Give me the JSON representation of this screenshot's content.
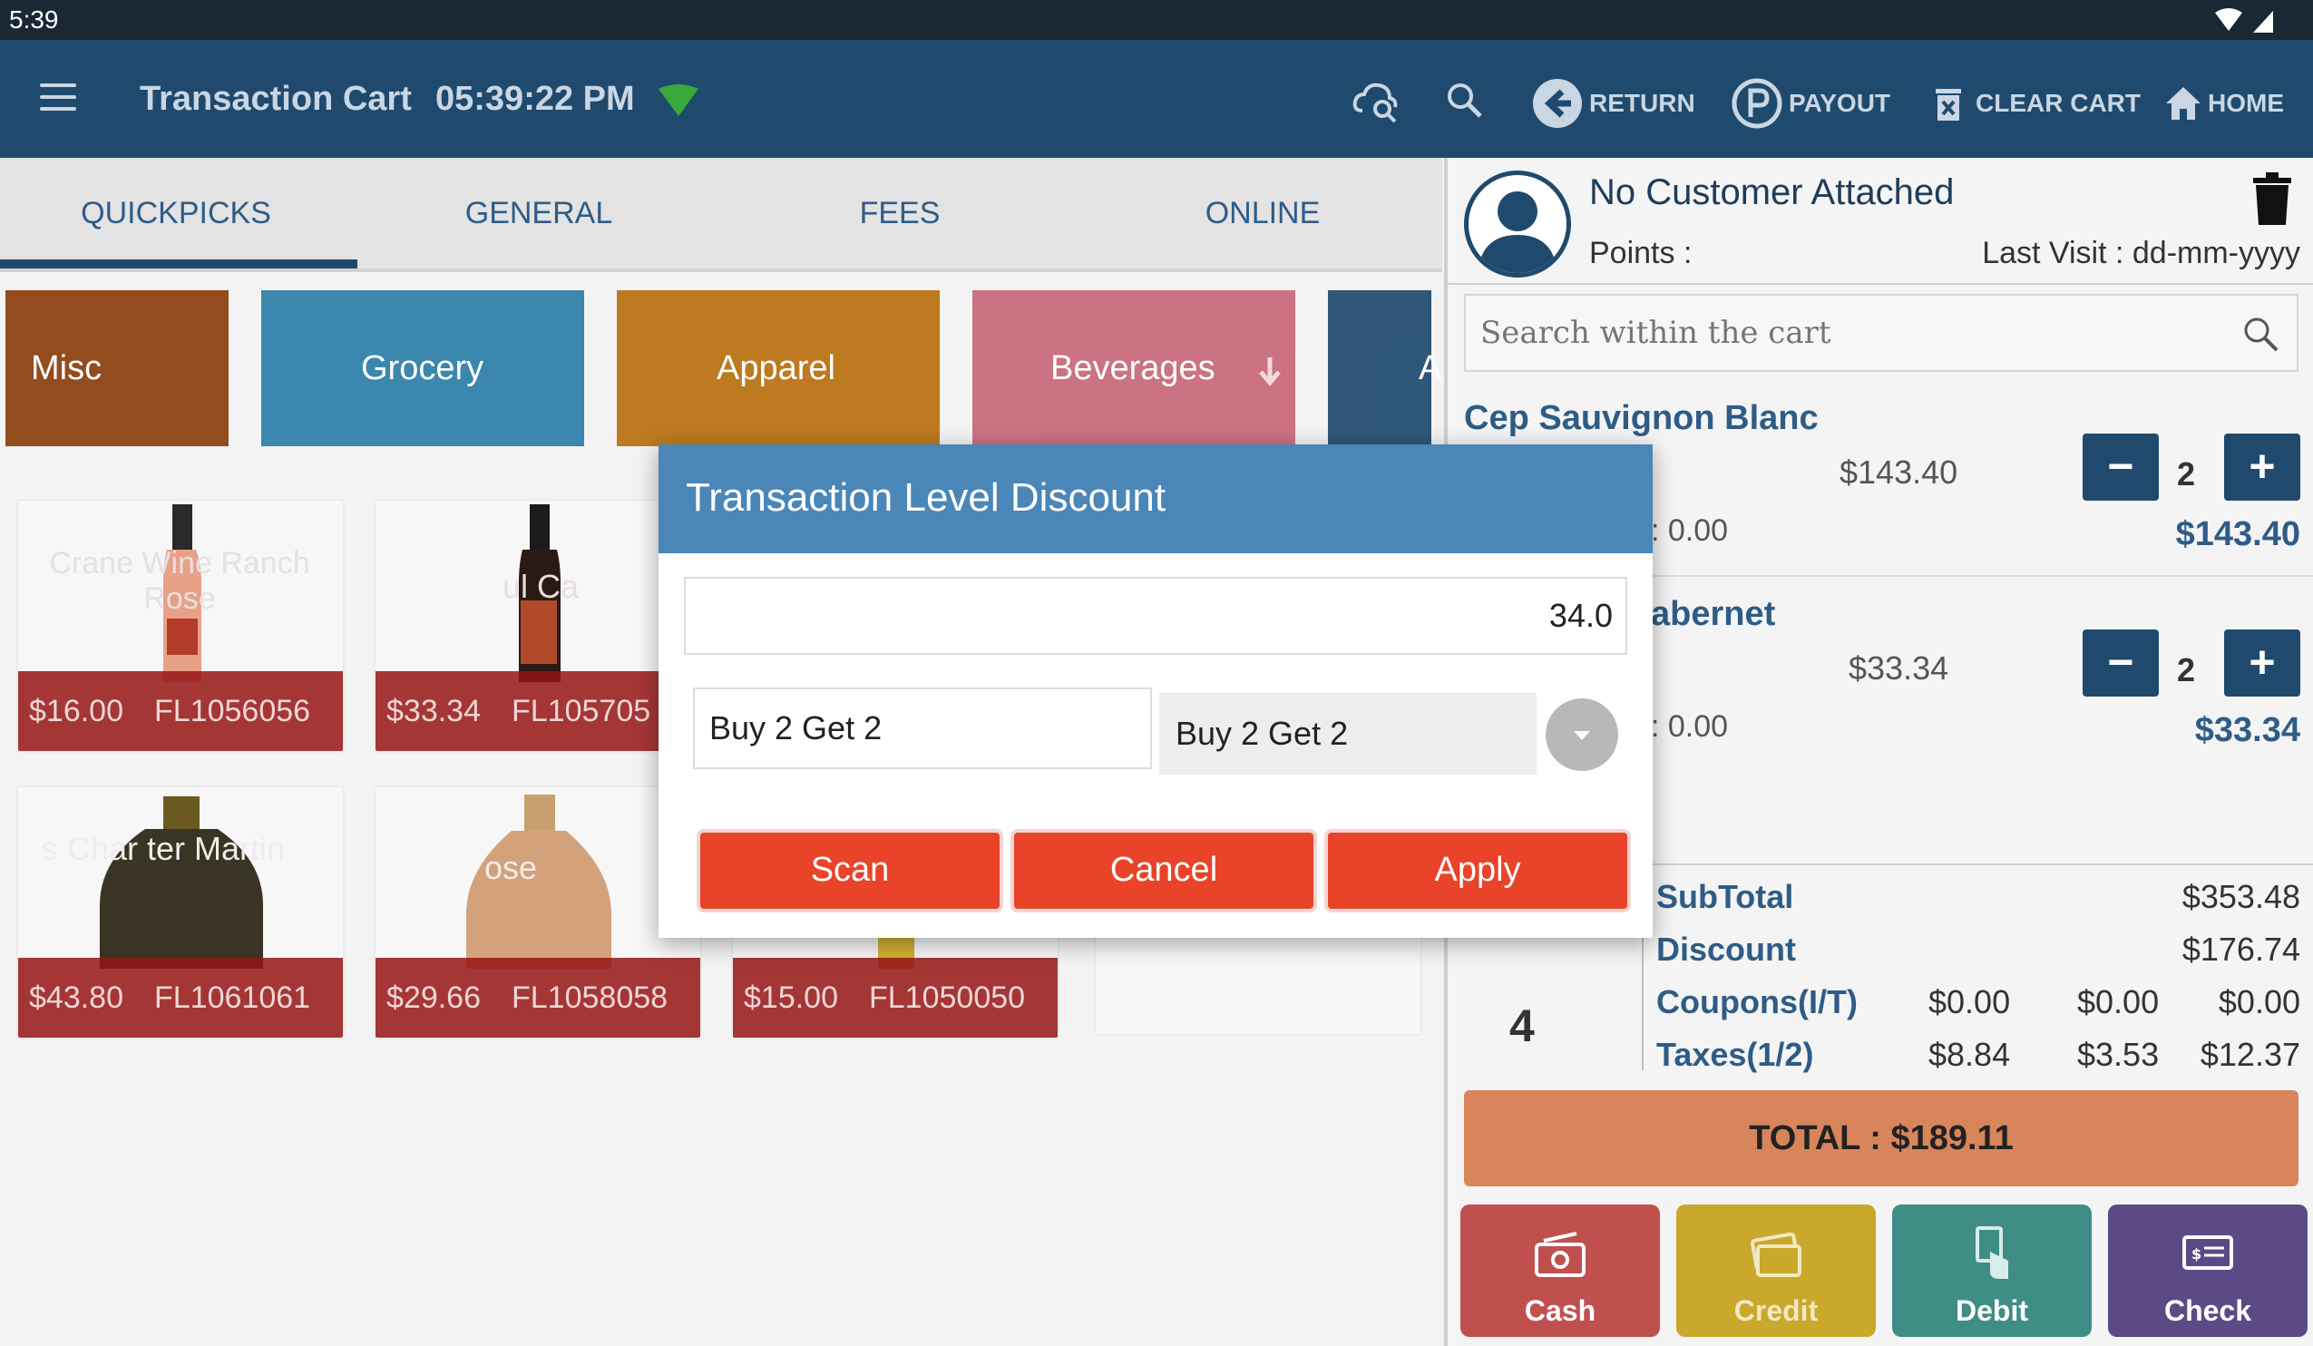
{
  "status_bar": {
    "time": "5:39"
  },
  "app_bar": {
    "title": "Transaction Cart",
    "clock": "05:39:22 PM",
    "actions": {
      "return": "RETURN",
      "payout": "PAYOUT",
      "clear_cart": "CLEAR CART",
      "home": "HOME"
    }
  },
  "tabs": [
    {
      "label": "QUICKPICKS",
      "active": true
    },
    {
      "label": "GENERAL",
      "active": false
    },
    {
      "label": "FEES",
      "active": false
    },
    {
      "label": "ONLINE",
      "active": false
    }
  ],
  "categories": [
    {
      "label": "Misc",
      "color": "#8a3e0c"
    },
    {
      "label": "Grocery",
      "color": "#2d7ea8"
    },
    {
      "label": "Apparel",
      "color": "#b9700f"
    },
    {
      "label": "Beverages",
      "color": "#c8687a"
    },
    {
      "label": "A",
      "color": "#1f4a6e"
    }
  ],
  "products": [
    {
      "price": "$16.00",
      "code": "FL1056056",
      "name_overlay": "Crane Wine Ranch Rose"
    },
    {
      "price": "$33.34",
      "code": "FL105705",
      "name_overlay": "ul Ca"
    },
    {
      "price": "$43.80",
      "code": "FL1061061",
      "name_overlay": "s Char ter Martin"
    },
    {
      "price": "$29.66",
      "code": "FL1058058",
      "name_overlay": "ose"
    },
    {
      "price": "$15.00",
      "code": "FL1050050",
      "name_overlay": ""
    }
  ],
  "customer": {
    "name": "No Customer Attached",
    "points_label": "Points :",
    "last_visit": "Last Visit : dd-mm-yyyy"
  },
  "cart_search": {
    "placeholder": "Search within the cart"
  },
  "cart_items": [
    {
      "name": "Cep Sauvignon Blanc",
      "unit_price": "$143.40",
      "tax": ": 0.00",
      "qty": "2",
      "total": "$143.40"
    },
    {
      "name": "abernet",
      "unit_price": "$33.34",
      "tax": ": 0.00",
      "qty": "2",
      "total": "$33.34"
    }
  ],
  "summary": {
    "item_count": "4",
    "subtotal_label": "SubTotal",
    "subtotal": "$353.48",
    "discount_label": "Discount",
    "discount": "$176.74",
    "coupons_label": "Coupons(I/T)",
    "coupons": [
      "$0.00",
      "$0.00",
      "$0.00"
    ],
    "taxes_label": "Taxes(1/2)",
    "taxes": [
      "$8.84",
      "$3.53",
      "$12.37"
    ],
    "total": "TOTAL : $189.11"
  },
  "payments": [
    {
      "label": "Cash",
      "color": "#c0504e"
    },
    {
      "label": "Credit",
      "color": "#c9a82c"
    },
    {
      "label": "Debit",
      "color": "#3f8e85"
    },
    {
      "label": "Check",
      "color": "#5b4a86"
    }
  ],
  "dialog": {
    "title": "Transaction Level Discount",
    "amount": "34.0",
    "promo_text": "Buy 2 Get 2",
    "promo_selected": "Buy 2 Get 2",
    "buttons": {
      "scan": "Scan",
      "cancel": "Cancel",
      "apply": "Apply"
    }
  },
  "colors": {
    "app_bar": "#1f4a6e",
    "dialog_header": "#4a86b8",
    "dialog_button": "#e9432a",
    "total_bar": "#d9855b"
  }
}
